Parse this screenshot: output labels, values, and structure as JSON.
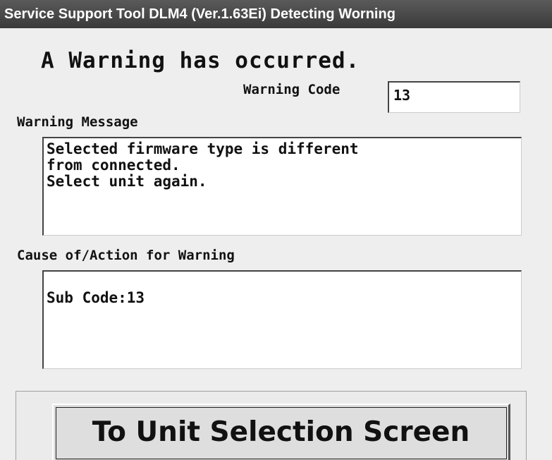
{
  "window": {
    "title": "Service Support Tool DLM4 (Ver.1.63Ei) Detecting Worning"
  },
  "dialog": {
    "headline": "A Warning has occurred.",
    "warning_code_label": "Warning Code",
    "warning_code_value": "13",
    "message_label": "Warning Message",
    "message_text": "Selected firmware type is different\nfrom connected.\nSelect unit again.",
    "cause_label": "Cause of/Action for Warning",
    "cause_text": "Sub Code:13"
  },
  "actions": {
    "primary_button_label": "To Unit Selection Screen"
  }
}
